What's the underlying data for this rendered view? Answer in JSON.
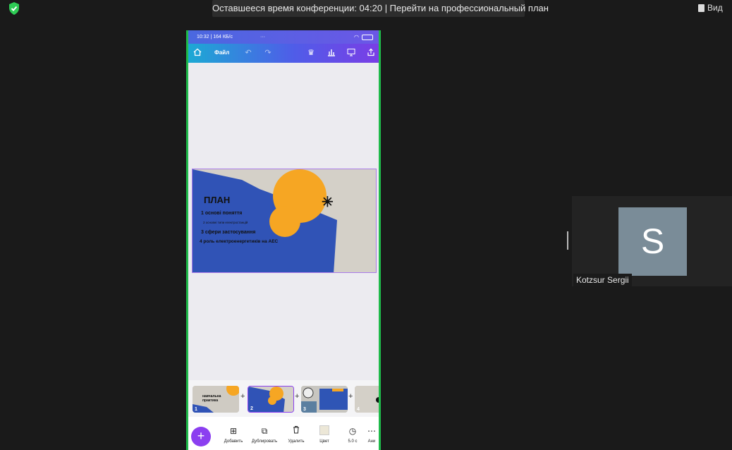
{
  "meeting": {
    "banner_text": "Оставшееся время конференции: 04:20 | Перейти на профессиональный план",
    "view_label": "Вид",
    "participant_name": "Kotzsur Sergii",
    "participant_initial": "S"
  },
  "phone": {
    "status_time": "10:32 | 164 КБ/с",
    "status_dots": "···",
    "toolbar": {
      "file_label": "Файл"
    },
    "slide": {
      "title": "ПЛАН",
      "items": [
        "1 основі поняття",
        "2 основні типи електростанцій",
        "3 сфери застосування",
        "4 роль електроенергетиків на  АЕС"
      ],
      "sun_color": "#f5a623",
      "panel_color": "#2f55b5"
    },
    "thumbnails": [
      {
        "num": "1",
        "caption": "навчальна практика"
      },
      {
        "num": "2",
        "caption": ""
      },
      {
        "num": "3",
        "caption": ""
      },
      {
        "num": "4",
        "caption": ""
      }
    ],
    "bottom": {
      "fab": "+",
      "items": [
        {
          "label": "Добавить",
          "icon": "add-page-icon"
        },
        {
          "label": "Дублировать",
          "icon": "duplicate-icon"
        },
        {
          "label": "Удалить",
          "icon": "trash-icon"
        },
        {
          "label": "Цвет",
          "icon": "color-swatch-icon"
        },
        {
          "label": "5.0 с",
          "icon": "clock-icon"
        },
        {
          "label": "Ани",
          "icon": "animation-icon"
        }
      ]
    }
  }
}
